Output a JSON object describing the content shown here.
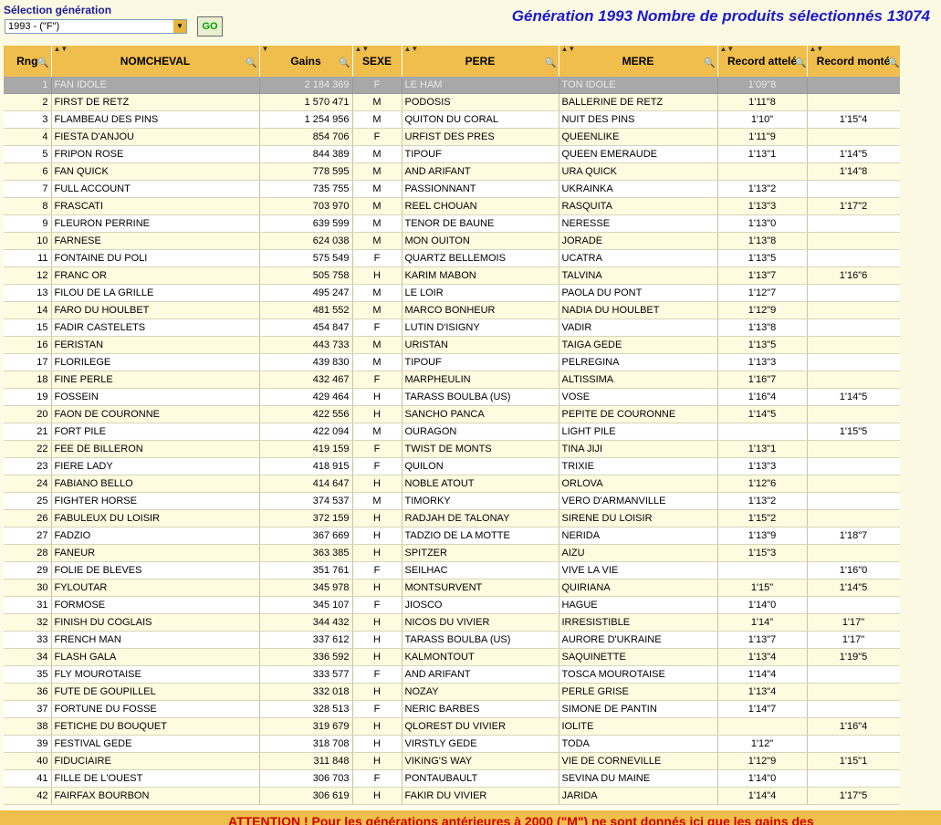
{
  "selection": {
    "label": "Sélection génération",
    "value": "1993 - (\"F\")",
    "go_label": "GO"
  },
  "title": "Génération 1993  Nombre de produits sélectionnés 13074",
  "columns": [
    "Rng",
    "NOMCHEVAL",
    "Gains",
    "SEXE",
    "PERE",
    "MERE",
    "Record attelé",
    "Record monté"
  ],
  "rows": [
    [
      "1",
      "FAN IDOLE",
      "2 184 369",
      "F",
      "LE HAM",
      "TON IDOLE",
      "1'09\"8",
      ""
    ],
    [
      "2",
      "FIRST DE RETZ",
      "1 570 471",
      "M",
      "PODOSIS",
      "BALLERINE DE RETZ",
      "1'11\"8",
      ""
    ],
    [
      "3",
      "FLAMBEAU DES PINS",
      "1 254 956",
      "M",
      "QUITON DU CORAL",
      "NUIT DES PINS",
      "1'10\"",
      "1'15\"4"
    ],
    [
      "4",
      "FIESTA D'ANJOU",
      "854 706",
      "F",
      "URFIST DES PRES",
      "QUEENLIKE",
      "1'11\"9",
      ""
    ],
    [
      "5",
      "FRIPON ROSE",
      "844 389",
      "M",
      "TIPOUF",
      "QUEEN EMERAUDE",
      "1'13\"1",
      "1'14\"5"
    ],
    [
      "6",
      "FAN QUICK",
      "778 595",
      "M",
      "AND ARIFANT",
      "URA QUICK",
      "",
      "1'14\"8"
    ],
    [
      "7",
      "FULL ACCOUNT",
      "735 755",
      "M",
      "PASSIONNANT",
      "UKRAINKA",
      "1'13\"2",
      ""
    ],
    [
      "8",
      "FRASCATI",
      "703 970",
      "M",
      "REEL CHOUAN",
      "RASQUITA",
      "1'13\"3",
      "1'17\"2"
    ],
    [
      "9",
      "FLEURON PERRINE",
      "639 599",
      "M",
      "TENOR DE BAUNE",
      "NERESSE",
      "1'13\"0",
      ""
    ],
    [
      "10",
      "FARNESE",
      "624 038",
      "M",
      "MON OUITON",
      "JORADE",
      "1'13\"8",
      ""
    ],
    [
      "11",
      "FONTAINE DU POLI",
      "575 549",
      "F",
      "QUARTZ BELLEMOIS",
      "UCATRA",
      "1'13\"5",
      ""
    ],
    [
      "12",
      "FRANC OR",
      "505 758",
      "H",
      "KARIM MABON",
      "TALVINA",
      "1'13\"7",
      "1'16\"6"
    ],
    [
      "13",
      "FILOU DE LA GRILLE",
      "495 247",
      "M",
      "LE LOIR",
      "PAOLA DU PONT",
      "1'12\"7",
      ""
    ],
    [
      "14",
      "FARO DU HOULBET",
      "481 552",
      "M",
      "MARCO BONHEUR",
      "NADIA DU HOULBET",
      "1'12\"9",
      ""
    ],
    [
      "15",
      "FADIR CASTELETS",
      "454 847",
      "F",
      "LUTIN D'ISIGNY",
      "VADIR",
      "1'13\"8",
      ""
    ],
    [
      "16",
      "FERISTAN",
      "443 733",
      "M",
      "URISTAN",
      "TAIGA GEDE",
      "1'13\"5",
      ""
    ],
    [
      "17",
      "FLORILEGE",
      "439 830",
      "M",
      "TIPOUF",
      "PELREGINA",
      "1'13\"3",
      ""
    ],
    [
      "18",
      "FINE PERLE",
      "432 467",
      "F",
      "MARPHEULIN",
      "ALTISSIMA",
      "1'16\"7",
      ""
    ],
    [
      "19",
      "FOSSEIN",
      "429 464",
      "H",
      "TARASS BOULBA (US)",
      "VOSE",
      "1'16\"4",
      "1'14\"5"
    ],
    [
      "20",
      "FAON DE COURONNE",
      "422 556",
      "H",
      "SANCHO PANCA",
      "PEPITE DE COURONNE",
      "1'14\"5",
      ""
    ],
    [
      "21",
      "FORT PILE",
      "422 094",
      "M",
      "OURAGON",
      "LIGHT PILE",
      "",
      "1'15\"5"
    ],
    [
      "22",
      "FEE DE BILLERON",
      "419 159",
      "F",
      "TWIST DE MONTS",
      "TINA JIJI",
      "1'13\"1",
      ""
    ],
    [
      "23",
      "FIERE LADY",
      "418 915",
      "F",
      "QUILON",
      "TRIXIE",
      "1'13\"3",
      ""
    ],
    [
      "24",
      "FABIANO BELLO",
      "414 647",
      "H",
      "NOBLE ATOUT",
      "ORLOVA",
      "1'12\"6",
      ""
    ],
    [
      "25",
      "FIGHTER HORSE",
      "374 537",
      "M",
      "TIMORKY",
      "VERO D'ARMANVILLE",
      "1'13\"2",
      ""
    ],
    [
      "26",
      "FABULEUX DU LOISIR",
      "372 159",
      "H",
      "RADJAH DE TALONAY",
      "SIRENE DU LOISIR",
      "1'15\"2",
      ""
    ],
    [
      "27",
      "FADZIO",
      "367 669",
      "H",
      "TADZIO DE LA MOTTE",
      "NERIDA",
      "1'13\"9",
      "1'18\"7"
    ],
    [
      "28",
      "FANEUR",
      "363 385",
      "H",
      "SPITZER",
      "AIZU",
      "1'15\"3",
      ""
    ],
    [
      "29",
      "FOLIE DE BLEVES",
      "351 761",
      "F",
      "SEILHAC",
      "VIVE LA VIE",
      "",
      "1'16\"0"
    ],
    [
      "30",
      "FYLOUTAR",
      "345 978",
      "H",
      "MONTSURVENT",
      "QUIRIANA",
      "1'15\"",
      "1'14\"5"
    ],
    [
      "31",
      "FORMOSE",
      "345 107",
      "F",
      "JIOSCO",
      "HAGUE",
      "1'14\"0",
      ""
    ],
    [
      "32",
      "FINISH DU COGLAIS",
      "344 432",
      "H",
      "NICOS DU VIVIER",
      "IRRESISTIBLE",
      "1'14\"",
      "1'17\""
    ],
    [
      "33",
      "FRENCH MAN",
      "337 612",
      "H",
      "TARASS BOULBA (US)",
      "AURORE D'UKRAINE",
      "1'13\"7",
      "1'17\""
    ],
    [
      "34",
      "FLASH GALA",
      "336 592",
      "H",
      "KALMONTOUT",
      "SAQUINETTE",
      "1'13\"4",
      "1'19\"5"
    ],
    [
      "35",
      "FLY MOUROTAISE",
      "333 577",
      "F",
      "AND ARIFANT",
      "TOSCA MOUROTAISE",
      "1'14\"4",
      ""
    ],
    [
      "36",
      "FUTE DE GOUPILLEL",
      "332 018",
      "H",
      "NOZAY",
      "PERLE GRISE",
      "1'13\"4",
      ""
    ],
    [
      "37",
      "FORTUNE DU FOSSE",
      "328 513",
      "F",
      "NERIC BARBES",
      "SIMONE DE PANTIN",
      "1'14\"7",
      ""
    ],
    [
      "38",
      "FETICHE DU BOUQUET",
      "319 679",
      "H",
      "QLOREST DU VIVIER",
      "IOLITE",
      "",
      "1'16\"4"
    ],
    [
      "39",
      "FESTIVAL GEDE",
      "318 708",
      "H",
      "VIRSTLY GEDE",
      "TODA",
      "1'12\"",
      ""
    ],
    [
      "40",
      "FIDUCIAIRE",
      "311 848",
      "H",
      "VIKING'S WAY",
      "VIE DE CORNEVILLE",
      "1'12\"9",
      "1'15\"1"
    ],
    [
      "41",
      "FILLE DE L'OUEST",
      "306 703",
      "F",
      "PONTAUBAULT",
      "SEVINA DU MAINE",
      "1'14\"0",
      ""
    ],
    [
      "42",
      "FAIRFAX BOURBON",
      "306 619",
      "H",
      "FAKIR DU VIVIER",
      "JARIDA",
      "1'14\"4",
      "1'17\"5"
    ]
  ],
  "warning": "ATTENTION ! Pour les générations antérieures à 2000 (\"M\") ne sont donnés ici que les gains des",
  "colors": {
    "header": "#f0be4c",
    "title": "#1a1acc",
    "warning": "#d00000",
    "selected_row": "#a8a8a8"
  },
  "icons": [
    "dropdown-arrow-icon",
    "sort-arrows-icon",
    "filter-magnifier-icon"
  ]
}
